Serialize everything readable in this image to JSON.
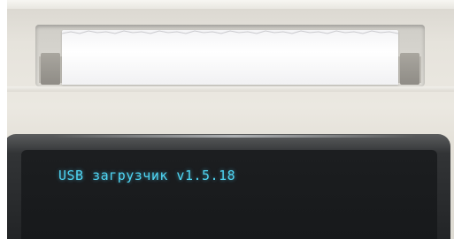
{
  "device": {
    "lcd": {
      "status_text": "USB загрузчик v1.5.18",
      "text_color": "#4fd6f4",
      "background_color": "#1c1e20"
    },
    "housing_color": "#e6e3dc",
    "paper_color": "#ffffff"
  }
}
